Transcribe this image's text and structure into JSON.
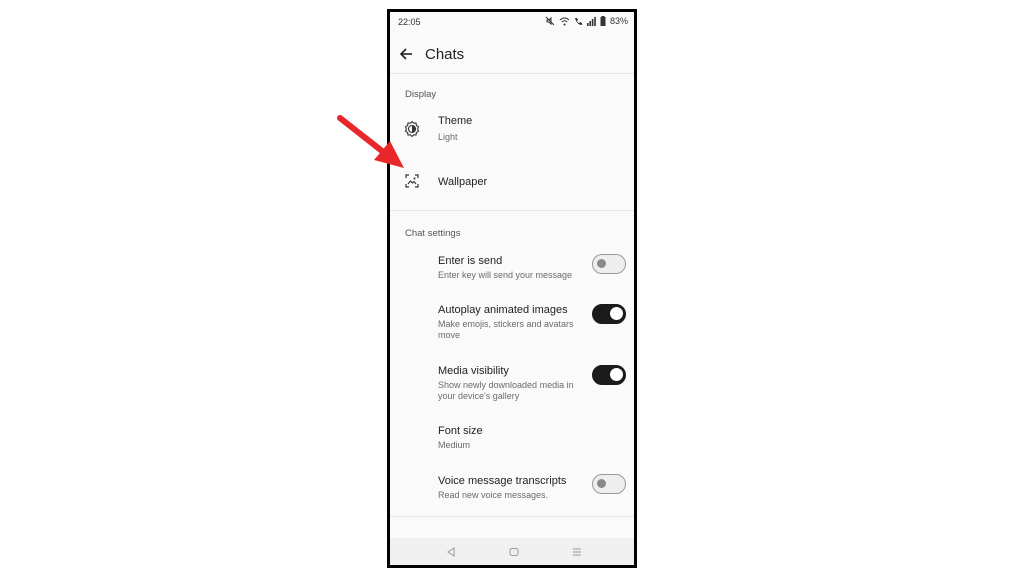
{
  "status_bar": {
    "time": "22:05",
    "battery_percent": "83%",
    "icons": [
      "mute-icon",
      "wifi-icon",
      "call-icon",
      "signal-icon",
      "battery-icon"
    ]
  },
  "app_bar": {
    "title": "Chats",
    "back_icon": "back-arrow-icon"
  },
  "display_section": {
    "header": "Display",
    "theme": {
      "title": "Theme",
      "subtitle": "Light",
      "icon": "theme-icon"
    },
    "wallpaper": {
      "title": "Wallpaper",
      "icon": "wallpaper-icon"
    }
  },
  "chat_settings": {
    "header": "Chat settings",
    "enter_is_send": {
      "title": "Enter is send",
      "subtitle": "Enter key will send your message",
      "enabled": false
    },
    "autoplay": {
      "title": "Autoplay animated images",
      "subtitle": "Make emojis, stickers and avatars move",
      "enabled": true
    },
    "media_visibility": {
      "title": "Media visibility",
      "subtitle": "Show newly downloaded media in your device's gallery",
      "enabled": true
    },
    "font_size": {
      "title": "Font size",
      "subtitle": "Medium"
    },
    "voice_transcripts": {
      "title": "Voice message transcripts",
      "subtitle": "Read new voice messages.",
      "enabled": false
    }
  },
  "nav_bar": {
    "back": "nav-back-icon",
    "home": "nav-home-icon",
    "recents": "nav-recents-icon"
  },
  "colors": {
    "annotation_arrow": "#e8272b",
    "switch_on": "#1b1b1b",
    "switch_off": "#eeeeee"
  }
}
